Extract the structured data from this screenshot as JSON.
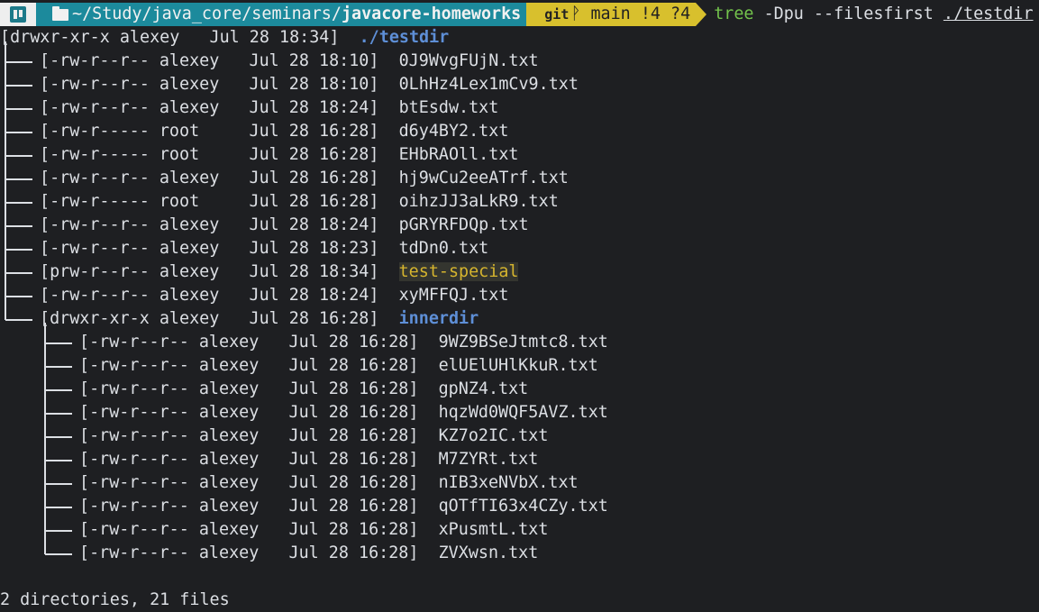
{
  "prompt": {
    "path_prefix": "~/Study/java_core/seminars/",
    "path_current": "javacore-homeworks",
    "git_label": "git",
    "branch_icon": "branch-icon",
    "branch": "main !4 ?4",
    "command": "tree",
    "args": " -Dpu --filesfirst ",
    "target": "./testdir"
  },
  "root": {
    "meta": "[drwxr-xr-x alexey   Jul 28 18:34]",
    "name": "./testdir"
  },
  "entries": [
    {
      "meta": "[-rw-r--r-- alexey   Jul 28 18:10]",
      "name": "0J9WvgFUjN.txt",
      "kind": "file"
    },
    {
      "meta": "[-rw-r--r-- alexey   Jul 28 18:10]",
      "name": "0LhHz4Lex1mCv9.txt",
      "kind": "file"
    },
    {
      "meta": "[-rw-r--r-- alexey   Jul 28 18:24]",
      "name": "btEsdw.txt",
      "kind": "file"
    },
    {
      "meta": "[-rw-r----- root     Jul 28 16:28]",
      "name": "d6y4BY2.txt",
      "kind": "file"
    },
    {
      "meta": "[-rw-r----- root     Jul 28 16:28]",
      "name": "EHbRAOll.txt",
      "kind": "file"
    },
    {
      "meta": "[-rw-r--r-- alexey   Jul 28 16:28]",
      "name": "hj9wCu2eeATrf.txt",
      "kind": "file"
    },
    {
      "meta": "[-rw-r----- root     Jul 28 16:28]",
      "name": "oihzJJ3aLkR9.txt",
      "kind": "file"
    },
    {
      "meta": "[-rw-r--r-- alexey   Jul 28 18:24]",
      "name": "pGRYRFDQp.txt",
      "kind": "file"
    },
    {
      "meta": "[-rw-r--r-- alexey   Jul 28 18:23]",
      "name": "tdDn0.txt",
      "kind": "file"
    },
    {
      "meta": "[prw-r--r-- alexey   Jul 28 18:34]",
      "name": "test-special",
      "kind": "pipe"
    },
    {
      "meta": "[-rw-r--r-- alexey   Jul 28 18:24]",
      "name": "xyMFFQJ.txt",
      "kind": "file"
    },
    {
      "meta": "[drwxr-xr-x alexey   Jul 28 16:28]",
      "name": "innerdir",
      "kind": "dir"
    }
  ],
  "inner_entries": [
    {
      "meta": "[-rw-r--r-- alexey   Jul 28 16:28]",
      "name": "9WZ9BSeJtmtc8.txt"
    },
    {
      "meta": "[-rw-r--r-- alexey   Jul 28 16:28]",
      "name": "elUElUHlKkuR.txt"
    },
    {
      "meta": "[-rw-r--r-- alexey   Jul 28 16:28]",
      "name": "gpNZ4.txt"
    },
    {
      "meta": "[-rw-r--r-- alexey   Jul 28 16:28]",
      "name": "hqzWd0WQF5AVZ.txt"
    },
    {
      "meta": "[-rw-r--r-- alexey   Jul 28 16:28]",
      "name": "KZ7o2IC.txt"
    },
    {
      "meta": "[-rw-r--r-- alexey   Jul 28 16:28]",
      "name": "M7ZYRt.txt"
    },
    {
      "meta": "[-rw-r--r-- alexey   Jul 28 16:28]",
      "name": "nIB3xeNVbX.txt"
    },
    {
      "meta": "[-rw-r--r-- alexey   Jul 28 16:28]",
      "name": "qOTfTI63x4CZy.txt"
    },
    {
      "meta": "[-rw-r--r-- alexey   Jul 28 16:28]",
      "name": "xPusmtL.txt"
    },
    {
      "meta": "[-rw-r--r-- alexey   Jul 28 16:28]",
      "name": "ZVXwsn.txt"
    }
  ],
  "summary": "2 directories, 21 files",
  "colors": {
    "background": "#1e1f22",
    "os_segment": "#eeeeee",
    "path_segment": "#1c8a9c",
    "git_segment": "#d8c02d",
    "command": "#73c34c",
    "directory": "#5e8fd7",
    "pipe": "#d6b52e"
  }
}
